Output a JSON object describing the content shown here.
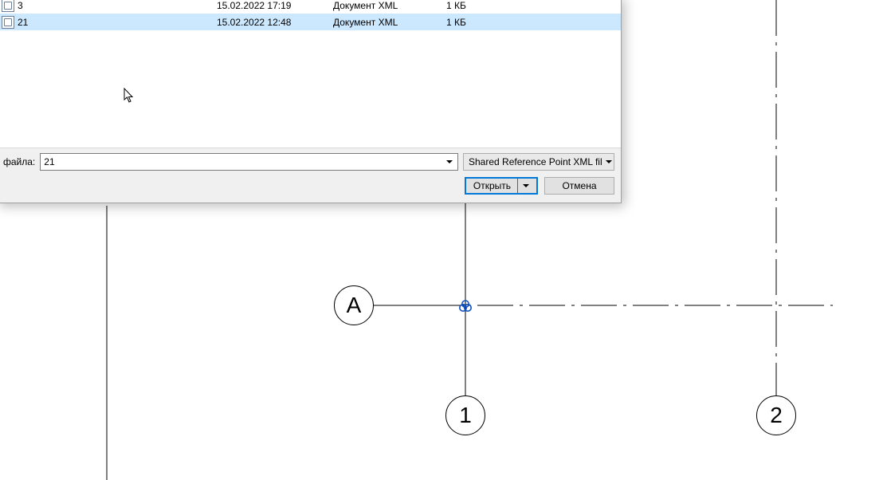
{
  "dialog": {
    "files": [
      {
        "name": "3",
        "date": "15.02.2022 17:19",
        "type": "Документ XML",
        "size": "1 КБ",
        "selected": false
      },
      {
        "name": "21",
        "date": "15.02.2022 12:48",
        "type": "Документ XML",
        "size": "1 КБ",
        "selected": true
      }
    ],
    "filename_label": "файла:",
    "filename_value": "21",
    "filter_value": "Shared Reference Point XML fil",
    "open_button": "Открыть",
    "cancel_button": "Отмена"
  },
  "grid": {
    "bubble_A": "А",
    "bubble_1": "1",
    "bubble_2": "2"
  }
}
